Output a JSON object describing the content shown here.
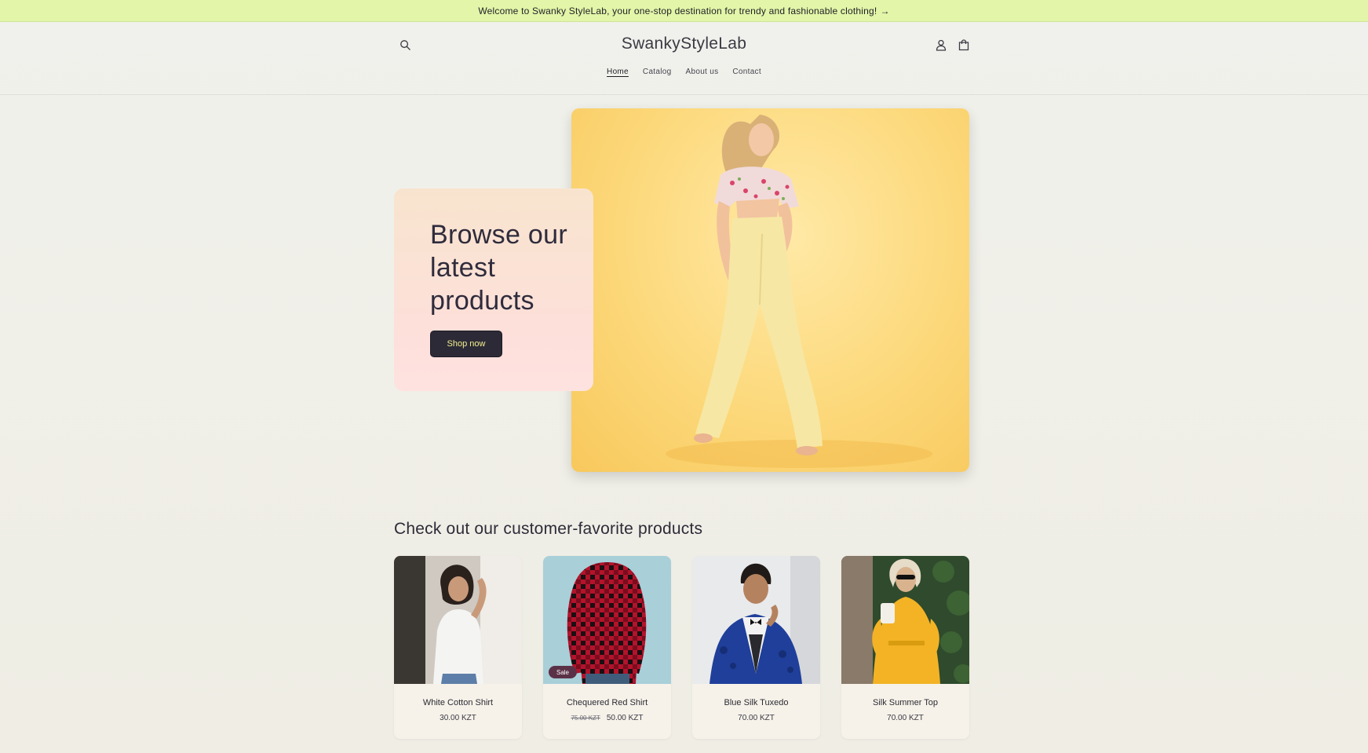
{
  "announcement": {
    "text": "Welcome to Swanky StyleLab, your one-stop destination for trendy and fashionable clothing!",
    "arrow": "→"
  },
  "header": {
    "logo": "SwankyStyleLab",
    "nav": [
      {
        "label": "Home"
      },
      {
        "label": "Catalog"
      },
      {
        "label": "About us"
      },
      {
        "label": "Contact"
      }
    ],
    "icons": [
      "search-icon",
      "account-icon",
      "cart-icon"
    ]
  },
  "hero": {
    "title": "Browse our latest products",
    "button_label": "Shop now"
  },
  "featured": {
    "title": "Check out our customer-favorite products",
    "products": [
      {
        "name": "White Cotton Shirt",
        "price": "30.00 KZT"
      },
      {
        "name": "Chequered Red Shirt",
        "old_price": "75.00 KZT",
        "price": "50.00 KZT",
        "badge": "Sale"
      },
      {
        "name": "Blue Silk Tuxedo",
        "price": "70.00 KZT"
      },
      {
        "name": "Silk Summer Top",
        "price": "70.00 KZT"
      }
    ]
  },
  "colors": {
    "announcement_bg": "#e2f5a8",
    "button_bg": "#2c2a37",
    "button_text": "#f3ef90",
    "sale_badge": "#5b3147"
  }
}
